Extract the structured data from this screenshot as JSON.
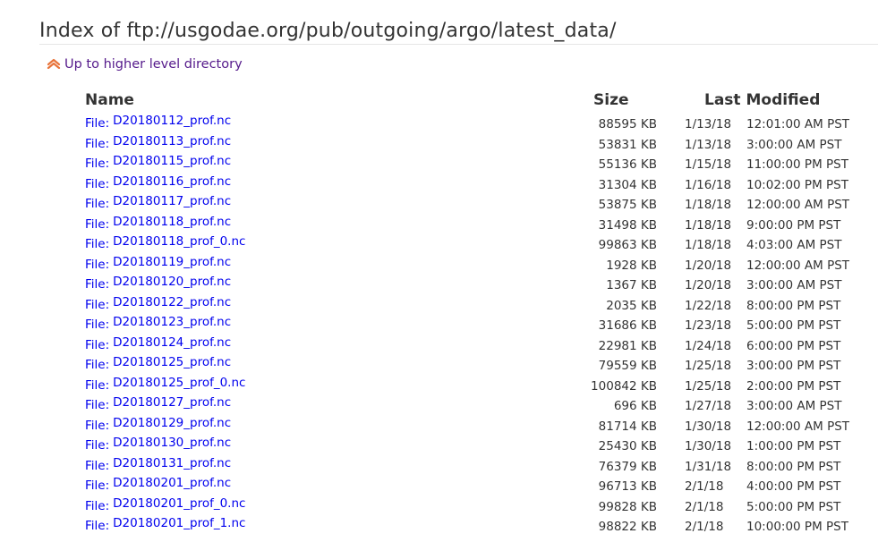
{
  "page": {
    "title": "Index of ftp://usgodae.org/pub/outgoing/argo/latest_data/",
    "up_link": "Up to higher level directory",
    "up_icon": "double-chevron-up-icon",
    "link_color": "#0000ee",
    "visited_color": "#551a8b"
  },
  "table": {
    "headers": {
      "name": "Name",
      "size": "Size",
      "last_modified": "Last Modified"
    },
    "file_prefix": "File:",
    "rows": [
      {
        "name": "D20180112_prof.nc",
        "size": "88595 KB",
        "date": "1/13/18",
        "time": "12:01:00 AM PST"
      },
      {
        "name": "D20180113_prof.nc",
        "size": "53831 KB",
        "date": "1/13/18",
        "time": "3:00:00 AM PST"
      },
      {
        "name": "D20180115_prof.nc",
        "size": "55136 KB",
        "date": "1/15/18",
        "time": "11:00:00 PM PST"
      },
      {
        "name": "D20180116_prof.nc",
        "size": "31304 KB",
        "date": "1/16/18",
        "time": "10:02:00 PM PST"
      },
      {
        "name": "D20180117_prof.nc",
        "size": "53875 KB",
        "date": "1/18/18",
        "time": "12:00:00 AM PST"
      },
      {
        "name": "D20180118_prof.nc",
        "size": "31498 KB",
        "date": "1/18/18",
        "time": "9:00:00 PM PST"
      },
      {
        "name": "D20180118_prof_0.nc",
        "size": "99863 KB",
        "date": "1/18/18",
        "time": "4:03:00 AM PST"
      },
      {
        "name": "D20180119_prof.nc",
        "size": "1928 KB",
        "date": "1/20/18",
        "time": "12:00:00 AM PST"
      },
      {
        "name": "D20180120_prof.nc",
        "size": "1367 KB",
        "date": "1/20/18",
        "time": "3:00:00 AM PST"
      },
      {
        "name": "D20180122_prof.nc",
        "size": "2035 KB",
        "date": "1/22/18",
        "time": "8:00:00 PM PST"
      },
      {
        "name": "D20180123_prof.nc",
        "size": "31686 KB",
        "date": "1/23/18",
        "time": "5:00:00 PM PST"
      },
      {
        "name": "D20180124_prof.nc",
        "size": "22981 KB",
        "date": "1/24/18",
        "time": "6:00:00 PM PST"
      },
      {
        "name": "D20180125_prof.nc",
        "size": "79559 KB",
        "date": "1/25/18",
        "time": "3:00:00 PM PST"
      },
      {
        "name": "D20180125_prof_0.nc",
        "size": "100842 KB",
        "date": "1/25/18",
        "time": "2:00:00 PM PST"
      },
      {
        "name": "D20180127_prof.nc",
        "size": "696 KB",
        "date": "1/27/18",
        "time": "3:00:00 AM PST"
      },
      {
        "name": "D20180129_prof.nc",
        "size": "81714 KB",
        "date": "1/30/18",
        "time": "12:00:00 AM PST"
      },
      {
        "name": "D20180130_prof.nc",
        "size": "25430 KB",
        "date": "1/30/18",
        "time": "1:00:00 PM PST"
      },
      {
        "name": "D20180131_prof.nc",
        "size": "76379 KB",
        "date": "1/31/18",
        "time": "8:00:00 PM PST"
      },
      {
        "name": "D20180201_prof.nc",
        "size": "96713 KB",
        "date": "2/1/18",
        "time": "4:00:00 PM PST"
      },
      {
        "name": "D20180201_prof_0.nc",
        "size": "99828 KB",
        "date": "2/1/18",
        "time": "5:00:00 PM PST"
      },
      {
        "name": "D20180201_prof_1.nc",
        "size": "98822 KB",
        "date": "2/1/18",
        "time": "10:00:00 PM PST"
      }
    ]
  }
}
